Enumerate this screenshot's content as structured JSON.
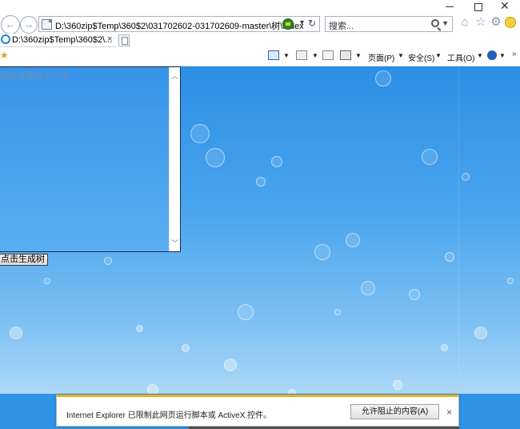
{
  "browser": {
    "address": "D:\\360zip$Temp\\360$2\\031702602-031702609-master\\树\\index",
    "search_placeholder": "搜索...",
    "tab_title": "D:\\360zip$Temp\\360$2\\...",
    "tab_close": "×",
    "window_close": "✕"
  },
  "command_bar": {
    "page_menu": "页面(P)",
    "safety_menu": "安全(S)",
    "tools_menu": "工具(O)",
    "more": "»"
  },
  "page": {
    "textarea_placeholder": "请在这里输入文字",
    "generate_button": "点击生成树"
  },
  "notification": {
    "message": "Internet Explorer 已限制此网页运行脚本或 ActiveX 控件。",
    "allow_button": "允许阻止的内容(A)",
    "close": "×"
  },
  "colors": {
    "page_bg_top": "#2b8fe6",
    "page_bg_bottom": "#c9e5fa",
    "notification_accent": "#e8b318"
  },
  "icons": [
    "back-arrow-icon",
    "forward-arrow-icon",
    "page-icon",
    "compatibility-icon",
    "refresh-icon",
    "search-icon",
    "home-icon",
    "favorites-star-icon",
    "gear-icon",
    "smiley-icon",
    "ie-tab-icon",
    "new-tab-icon",
    "add-favorites-icon",
    "rss-icon",
    "mail-icon",
    "print-icon",
    "help-icon"
  ]
}
